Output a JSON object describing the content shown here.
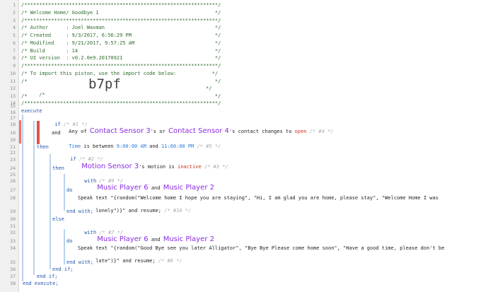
{
  "line_numbers": [
    "1",
    "2",
    "3",
    "4",
    "5",
    "6",
    "7",
    "8",
    "9",
    "10",
    "11",
    "12",
    "13",
    "14",
    "15",
    "16",
    "17",
    "18",
    "19",
    "20",
    "21",
    "22",
    "23",
    "24",
    "25",
    "26",
    "27",
    "28",
    "29",
    "30",
    "31",
    "32",
    "33",
    "34",
    "35",
    "36",
    "37",
    "38"
  ],
  "header": {
    "l1": "/*****************************************************************/",
    "l2": "/* Welcome Home/ Goodbye 1                                       */",
    "l3": "/*****************************************************************/",
    "l4": "/* Author      : Joel Waxman                                     */",
    "l5": "/* Created     : 9/3/2017, 6:56:29 PM                            */",
    "l6": "/* Modified    : 9/21/2017, 9:57:25 AM                           */",
    "l7": "/* Build       : 14                                              */",
    "l8": "/* UI version  : v0.2.0e9.20170921                               */",
    "l9": "/*****************************************************************/",
    "l10": "/* To import this piston, use the import code below:            */",
    "l11": "/*                                                               */",
    "l12_pre": "/*",
    "l12_code": "b7pf",
    "l12_post": "*/",
    "l13": "/*                                                               */",
    "l14": "/*****************************************************************/"
  },
  "code": {
    "execute": "execute",
    "if_kw": "if",
    "c1": "/* #1 */",
    "any_of": "Any of",
    "dev_cs3": "Contact Sensor 3",
    "s_or": "'s or",
    "dev_cs4": "Contact Sensor 4",
    "contact_changes": "'s contact changes to",
    "open": "open",
    "c4": "/* #4 */",
    "and": "and",
    "time_kw": "Time",
    "between": "is between",
    "t1": "9:00:00 AM",
    "and2": "and",
    "t2": "11:00:00 PM",
    "c5": "/* #5 */",
    "then": "then",
    "if2": "if",
    "c2": "/* #2 */",
    "dev_ms3": "Motion Sensor 3",
    "motion_is": "'s motion is",
    "inactive": "inactive",
    "c3": "/* #3 */",
    "then2": "then",
    "with": "with",
    "c9": "/* #9 */",
    "dev_mp6": "Music Player 6",
    "and3": "and",
    "dev_mp2": "Music Player 2",
    "do": "do",
    "speak1a": "Speak text \"{random(\"Welcome home I hope you are staying\", \"Hi, I am glad you are home, please stay\", \"Welcome Home I was",
    "speak1b": "lonely\")}\" and resume;",
    "c10": "/* #10 */",
    "end_with": "end with;",
    "else": "else",
    "with2": "with",
    "c7": "/* #7 */",
    "do2": "do",
    "speak2a": "Speak text \"{random(\"Good Bye see you later Alligator\", \"Bye Bye Please come home soon\", \"Have a good time, please don't be",
    "speak2b": "late\")}\" and resume;",
    "c8": "/* #8 */",
    "end_with2": "end with;",
    "end_if": "end if;",
    "end_if2": "end if;",
    "end_execute": "end execute;"
  }
}
